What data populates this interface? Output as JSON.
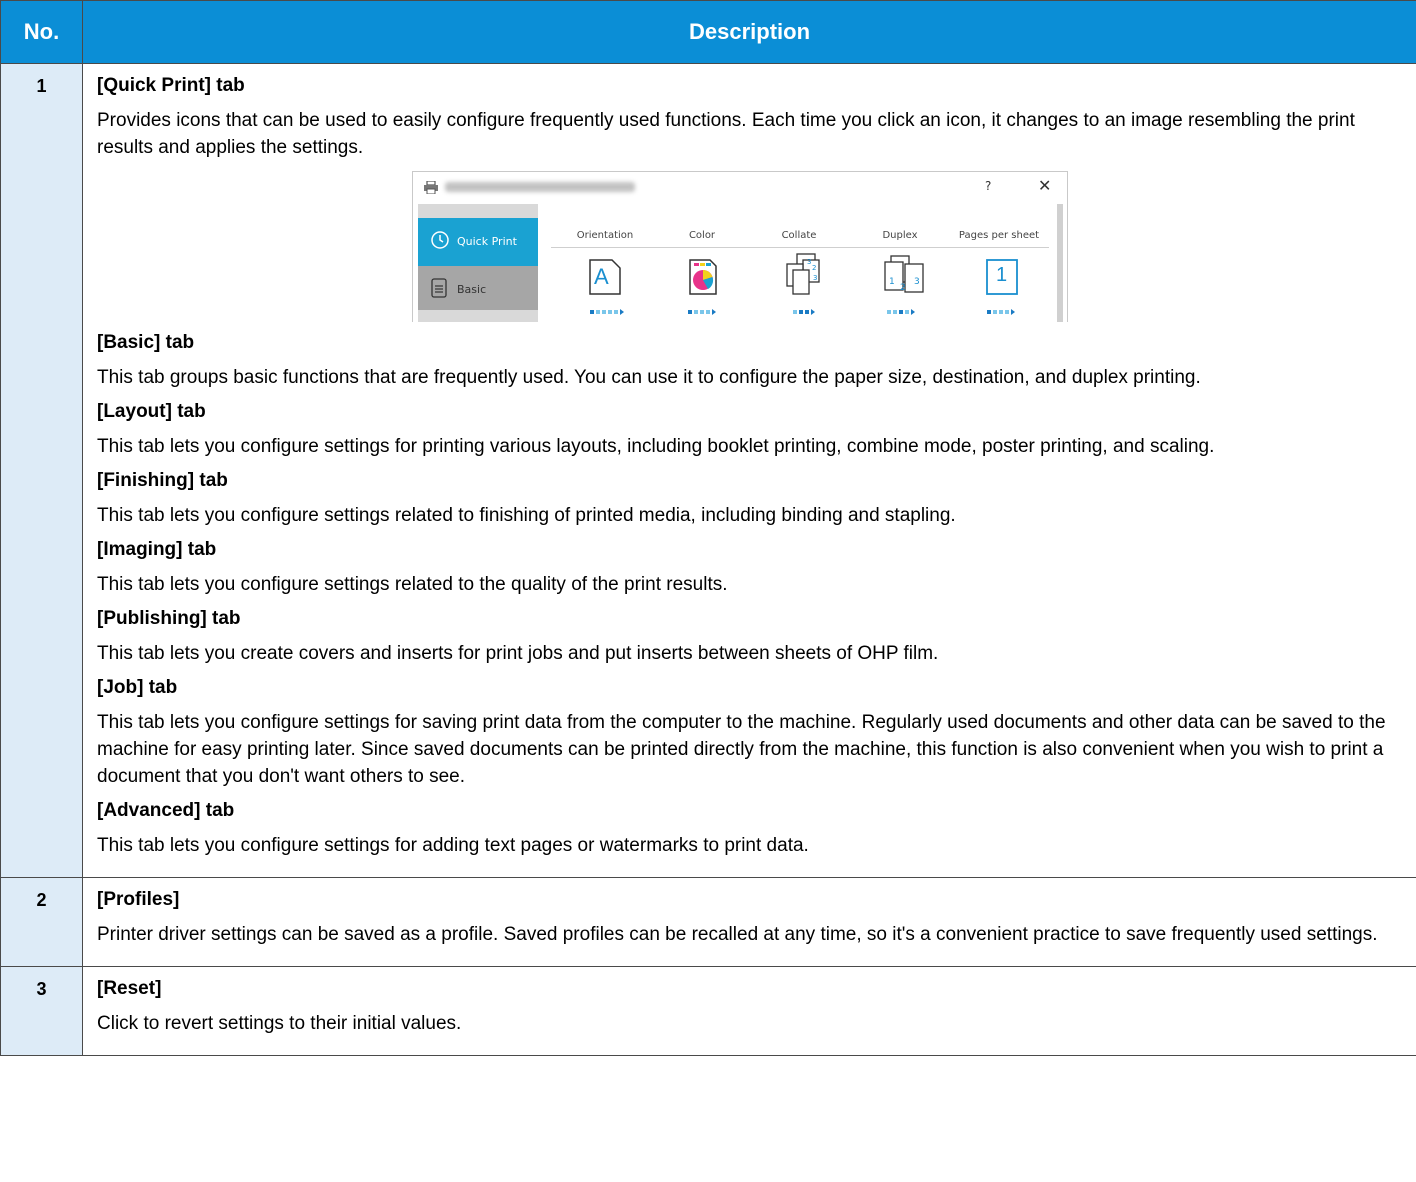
{
  "header": {
    "no": "No.",
    "description": "Description"
  },
  "row1": {
    "number": "1",
    "sections": [
      {
        "heading": "[Quick Print] tab",
        "text": "Provides icons that can be used to easily configure frequently used functions. Each time you click an icon, it changes to an image resembling the print results and applies the settings."
      },
      {
        "heading": "[Basic] tab",
        "text": "This tab groups basic functions that are frequently used. You can use it to configure the paper size, destination, and duplex printing."
      },
      {
        "heading": "[Layout] tab",
        "text": "This tab lets you configure settings for printing various layouts, including booklet printing, combine mode, poster printing, and scaling."
      },
      {
        "heading": "[Finishing] tab",
        "text": "This tab lets you configure settings related to finishing of printed media, including binding and stapling."
      },
      {
        "heading": "[Imaging] tab",
        "text": "This tab lets you configure settings related to the quality of the print results."
      },
      {
        "heading": "[Publishing] tab",
        "text": "This tab lets you create covers and inserts for print jobs and put inserts between sheets of OHP film."
      },
      {
        "heading": "[Job] tab",
        "text": "This tab lets you configure settings for saving print data from the computer to the machine. Regularly used documents and other data can be saved to the machine for easy printing later. Since saved documents can be printed directly from the machine, this function is also convenient when you wish to print a document that you don't want others to see."
      },
      {
        "heading": "[Advanced] tab",
        "text": "This tab lets you configure settings for adding text pages or watermarks to print data."
      }
    ]
  },
  "dialog": {
    "help": "?",
    "close": "✕",
    "tabs": {
      "quick_print": "Quick Print",
      "basic": "Basic"
    },
    "columns": [
      "Orientation",
      "Color",
      "Collate",
      "Duplex",
      "Pages per sheet"
    ],
    "orientation_glyph": "A",
    "pages_glyph": "1",
    "accent": "#1aa2d2"
  },
  "row2": {
    "number": "2",
    "heading": "[Profiles]",
    "text": "Printer driver settings can be saved as a profile. Saved profiles can be recalled at any time, so it's a convenient practice to save frequently used settings."
  },
  "row3": {
    "number": "3",
    "heading": "[Reset]",
    "text": "Click to revert settings to their initial values."
  }
}
